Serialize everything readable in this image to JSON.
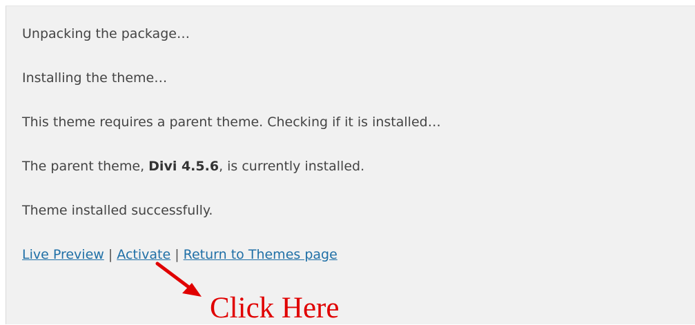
{
  "log": {
    "unpacking": "Unpacking the package…",
    "installing": "Installing the theme…",
    "requires_parent": "This theme requires a parent theme. Checking if it is installed…",
    "parent_prefix": "The parent theme, ",
    "parent_name": "Divi 4.5.6",
    "parent_suffix": ", is currently installed.",
    "success": "Theme installed successfully."
  },
  "actions": {
    "live_preview": "Live Preview",
    "activate": "Activate",
    "return_themes": "Return to Themes page",
    "separator": " | "
  },
  "annotation": {
    "text": "Click Here",
    "color": "#e00000",
    "arrow_icon": "arrow-icon"
  },
  "colors": {
    "background": "#f1f1f1",
    "text": "#444444",
    "link": "#1f6fa6"
  }
}
